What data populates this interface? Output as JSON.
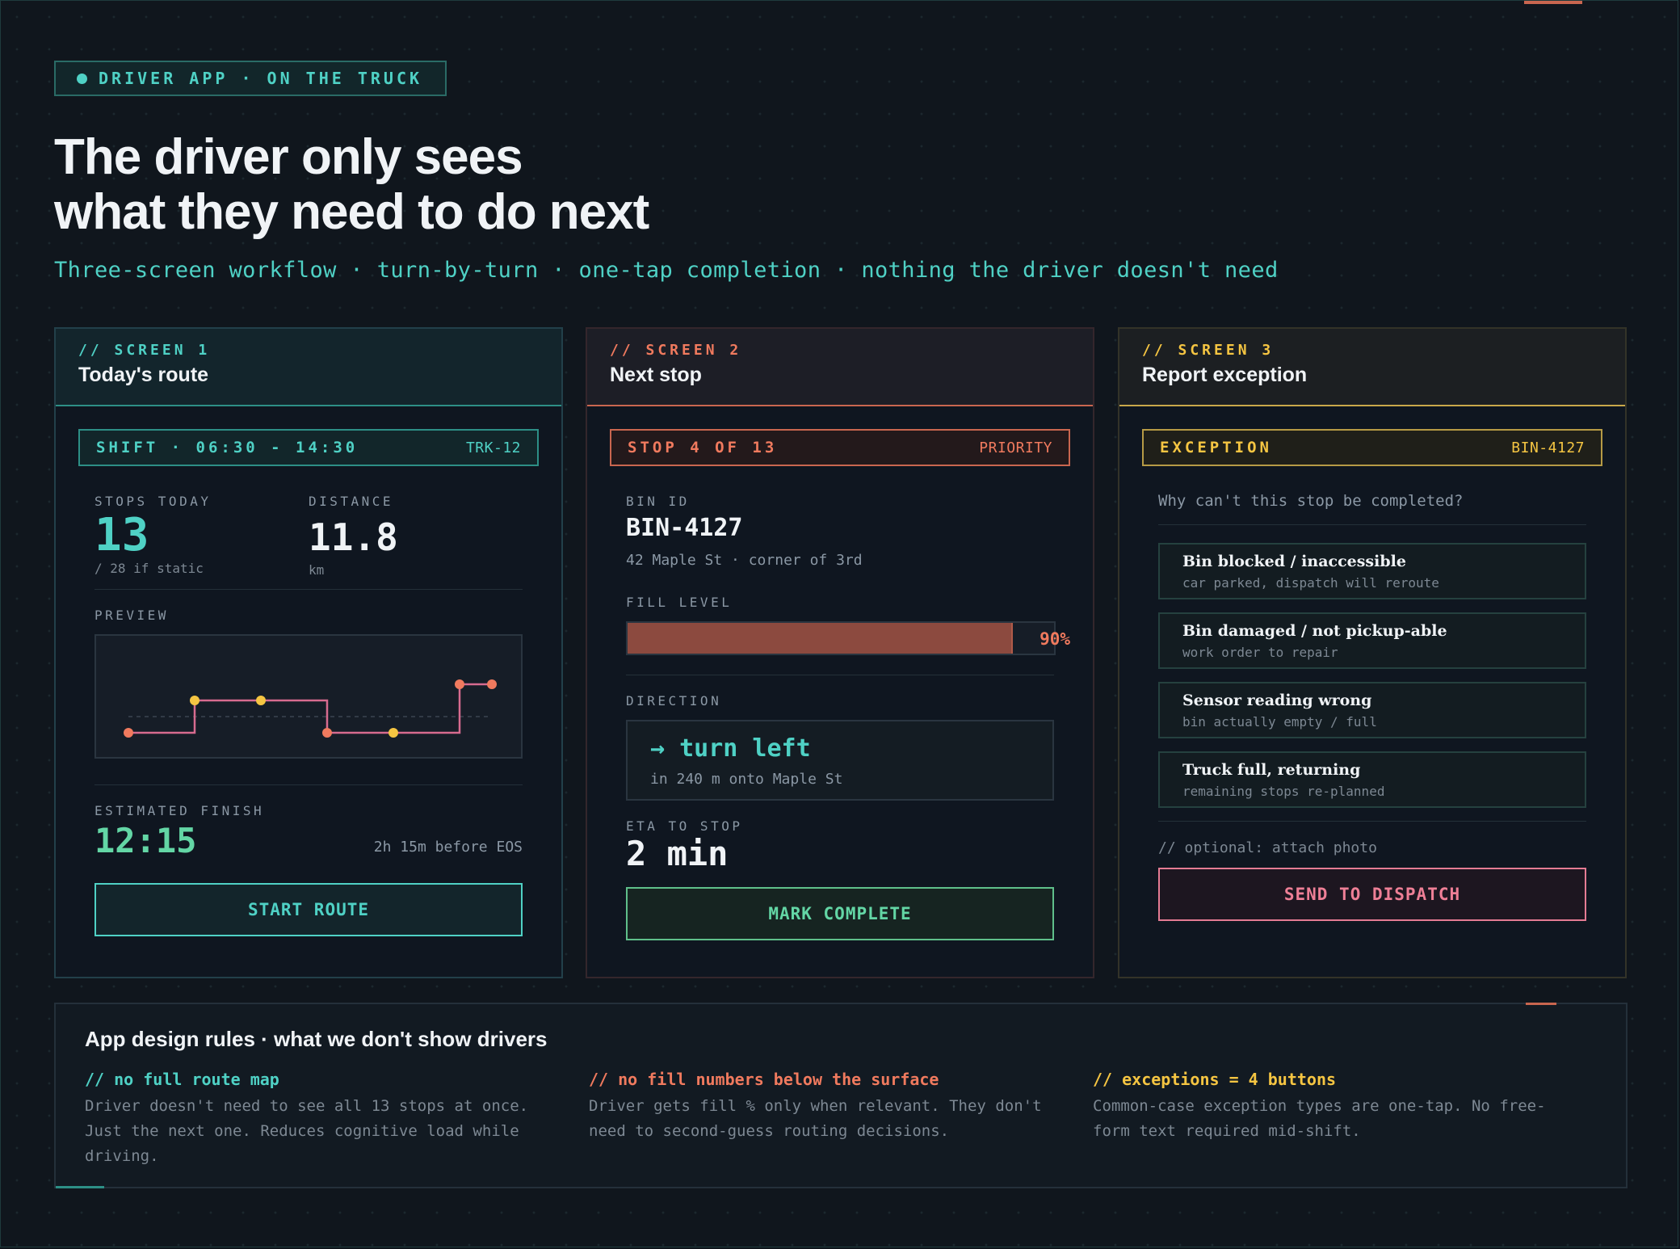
{
  "tag": "DRIVER APP · ON THE TRUCK",
  "headline": {
    "line1": "The driver only sees",
    "line2": "what they need to do next"
  },
  "subtitle": "Three-screen workflow · turn-by-turn · one-tap completion · nothing the driver doesn't need",
  "colors": {
    "teal": "#4fd1c5",
    "coral": "#f07a5e",
    "yellow": "#f5c542",
    "green": "#63d6a5",
    "pink": "#ee7f96",
    "route_line": "#d76b8f"
  },
  "screen1": {
    "number": "// SCREEN 1",
    "title": "Today's route",
    "shift": "SHIFT · 06:30 - 14:30",
    "truck": "TRK-12",
    "stops_label": "STOPS TODAY",
    "stops_value": "13",
    "stops_note": "/ 28 if static",
    "distance_label": "DISTANCE",
    "distance_value": "11.8",
    "distance_unit": "km",
    "preview_label": "PREVIEW",
    "preview_markers": [
      "start",
      "stop",
      "stop",
      "start",
      "stop",
      "start",
      "start"
    ],
    "finish_label": "ESTIMATED FINISH",
    "finish_time": "12:15",
    "finish_note": "2h 15m before EOS",
    "button": "START ROUTE"
  },
  "screen2": {
    "number": "// SCREEN 2",
    "title": "Next stop",
    "stop": "STOP 4 OF 13",
    "priority": "PRIORITY",
    "bin_label": "BIN ID",
    "bin_id": "BIN-4127",
    "address": "42 Maple St · corner of 3rd",
    "fill_label": "FILL LEVEL",
    "fill_percent": 90,
    "fill_text": "90%",
    "direction_label": "DIRECTION",
    "direction": "→ turn left",
    "direction_detail": "in 240 m onto Maple St",
    "eta_label": "ETA TO STOP",
    "eta": "2 min",
    "button": "MARK COMPLETE"
  },
  "screen3": {
    "number": "// SCREEN 3",
    "title": "Report exception",
    "exception": "EXCEPTION",
    "bin": "BIN-4127",
    "question": "Why can't this stop be completed?",
    "options": [
      {
        "title": "Bin blocked / inaccessible",
        "sub": "car parked, dispatch will reroute"
      },
      {
        "title": "Bin damaged / not pickup-able",
        "sub": "work order to repair"
      },
      {
        "title": "Sensor reading wrong",
        "sub": "bin actually empty / full"
      },
      {
        "title": "Truck full, returning",
        "sub": "remaining stops re-planned"
      }
    ],
    "optional": "// optional: attach photo",
    "button": "SEND TO DISPATCH"
  },
  "rules": {
    "title": "App design rules · what we don't show drivers",
    "items": [
      {
        "head": "// no full route map",
        "body": "Driver doesn't need to see all 13 stops at once. Just the next one. Reduces cognitive load while driving."
      },
      {
        "head": "// no fill numbers below the surface",
        "body": "Driver gets fill % only when relevant. They don't need to second-guess routing decisions."
      },
      {
        "head": "// exceptions = 4 buttons",
        "body": "Common-case exception types are one-tap. No free-form text required mid-shift."
      }
    ]
  }
}
